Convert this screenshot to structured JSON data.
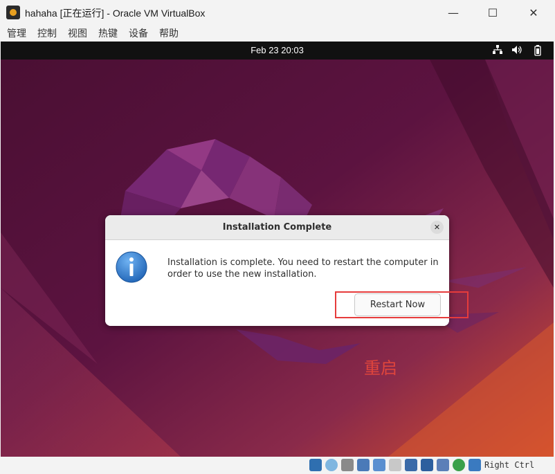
{
  "window": {
    "title": "hahaha [正在运行] - Oracle VM VirtualBox",
    "minimize_glyph": "—",
    "maximize_glyph": "☐",
    "close_glyph": "✕"
  },
  "menubar": {
    "items": [
      "管理",
      "控制",
      "视图",
      "热键",
      "设备",
      "帮助"
    ]
  },
  "guest_topbar": {
    "clock": "Feb 23  20:03",
    "tray_icons": [
      "network-icon",
      "volume-icon",
      "battery-icon"
    ]
  },
  "dialog": {
    "title": "Installation Complete",
    "close_glyph": "✕",
    "message": "Installation is complete. You need to restart the computer in order to use the new installation.",
    "restart_label": "Restart Now"
  },
  "annotation": {
    "text": "重启",
    "color": "#e0453c"
  },
  "statusbar": {
    "host_key": "Right Ctrl",
    "icons": [
      "hard-disk-icon",
      "optical-drive-icon",
      "audio-icon",
      "network-adapter-icon",
      "usb-icon",
      "shared-folder-icon",
      "display-icon",
      "recording-icon",
      "virtualization-icon",
      "mouse-integration-icon",
      "keyboard-capture-icon"
    ]
  },
  "colors": {
    "vm_topbar": "#111111",
    "highlight_border": "#e63b3b",
    "info_icon": "#2f7bd0"
  }
}
